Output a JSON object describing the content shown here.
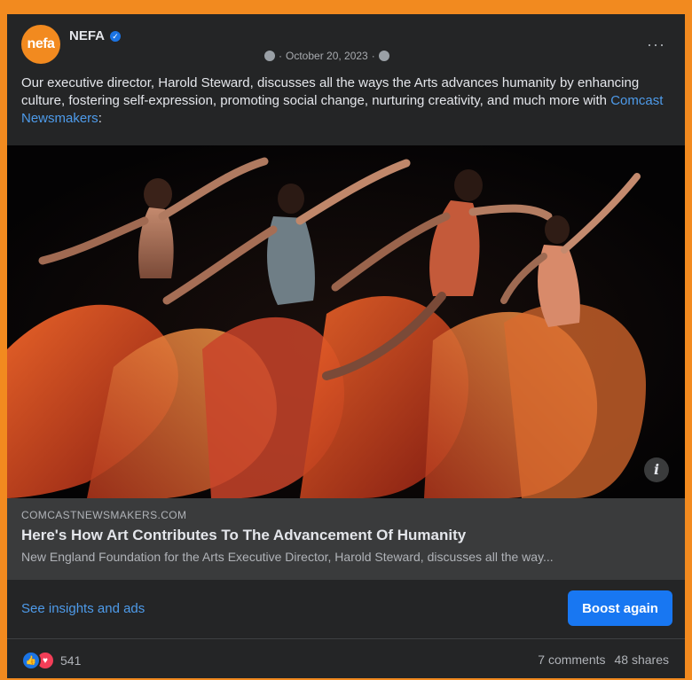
{
  "post": {
    "page_name": "NEFA",
    "avatar_text": "nefa",
    "date": "October 20, 2023",
    "more_label": "···",
    "text_main": "Our executive director, Harold Steward, discusses all the ways the Arts advances humanity by enhancing culture, fostering self-expression, promoting social change, nurturing creativity, and much more with ",
    "text_link": "Comcast Newsmakers",
    "text_end": ":"
  },
  "link_preview": {
    "domain": "COMCASTNEWSMAKERS.COM",
    "title": "Here's How Art Contributes To The Advancement Of Humanity",
    "description": "New England Foundation for the Arts Executive Director, Harold Steward, discusses all the way...",
    "info_label": "i"
  },
  "actions": {
    "insights_label": "See insights and ads",
    "boost_label": "Boost again"
  },
  "stats": {
    "reaction_count": "541",
    "comments": "7 comments",
    "shares": "48 shares"
  },
  "colors": {
    "brand_orange": "#f28a1f",
    "card_bg": "#242526",
    "link_blue": "#4e9bea",
    "button_blue": "#1877f2"
  },
  "icons": [
    "verified-badge-icon",
    "globe-icon",
    "more-options-icon",
    "info-icon",
    "like-reaction-icon",
    "love-reaction-icon"
  ]
}
